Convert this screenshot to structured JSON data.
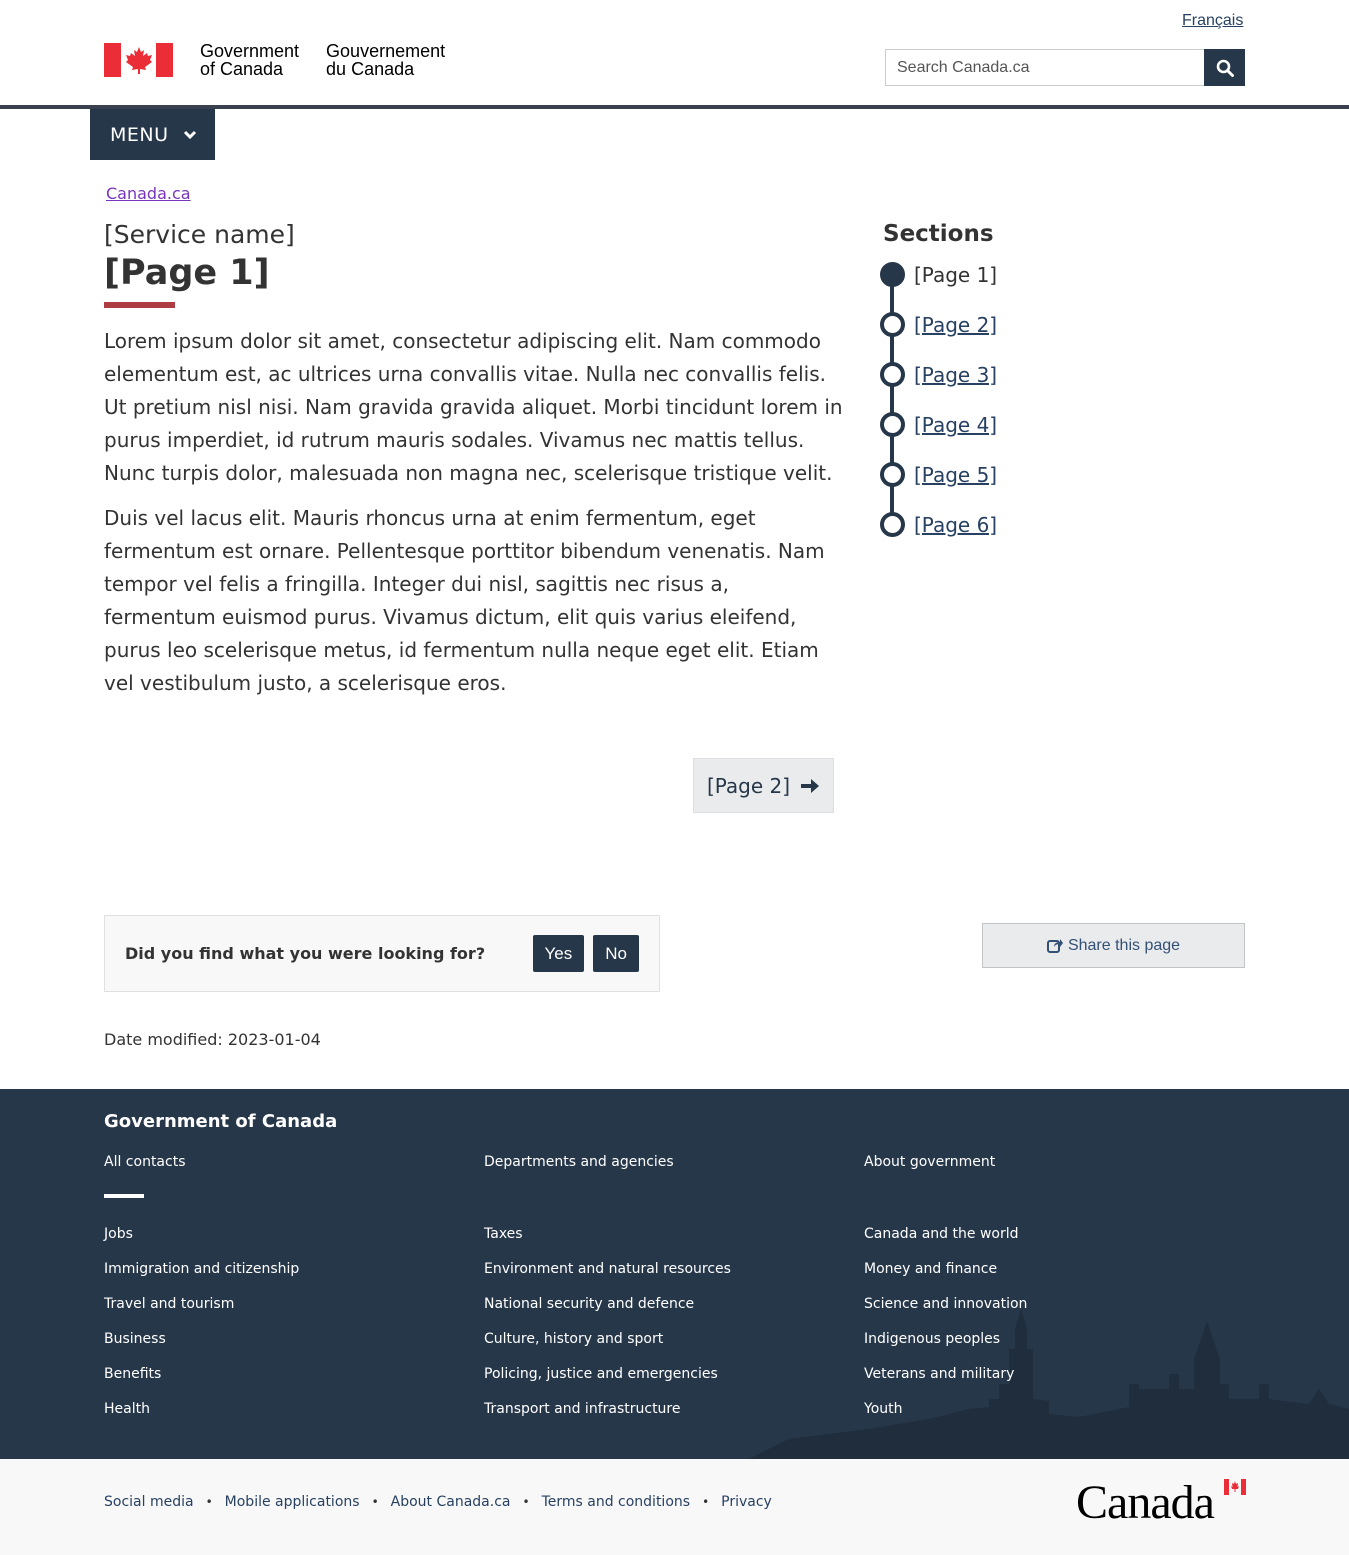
{
  "header": {
    "language_link": "Français",
    "wordmark_en": "Government\nof Canada",
    "wordmark_fr": "Gouvernement\ndu Canada",
    "search_placeholder": "Search Canada.ca",
    "menu_label": "MENU",
    "icons": {
      "search": "search-icon",
      "menu_chevron": "chevron-down-icon",
      "flag": "canada-flag-icon"
    },
    "colors": {
      "flag_red": "#eb2d37",
      "nav_dark": "#26374a"
    }
  },
  "breadcrumb": {
    "items": [
      "Canada.ca"
    ]
  },
  "main": {
    "service_name": "[Service name]",
    "page_title": "[Page 1]",
    "paragraphs": [
      "Lorem ipsum dolor sit amet, consectetur adipiscing elit. Nam commodo elementum est, ac ultrices urna convallis vitae. Nulla nec convallis felis. Ut pretium nisl nisi. Nam gravida gravida aliquet. Morbi tincidunt lorem in purus imperdiet, id rutrum mauris sodales. Vivamus nec mattis tellus. Nunc turpis dolor, malesuada non magna nec, scelerisque tristique velit.",
      "Duis vel lacus elit. Mauris rhoncus urna at enim fermentum, eget fermentum est ornare. Pellentesque porttitor bibendum venenatis. Nam tempor vel felis a fringilla. Integer dui nisl, sagittis nec risus a, fermentum euismod purus. Vivamus dictum, elit quis varius eleifend, purus leo scelerisque metus, id fermentum nulla neque eget elit. Etiam vel vestibulum justo, a scelerisque eros."
    ],
    "next_button": "[Page 2]",
    "accent_color": "#af3c43"
  },
  "sections": {
    "title": "Sections",
    "items": [
      {
        "label": "[Page 1]",
        "current": true
      },
      {
        "label": "[Page 2]",
        "current": false
      },
      {
        "label": "[Page 3]",
        "current": false
      },
      {
        "label": "[Page 4]",
        "current": false
      },
      {
        "label": "[Page 5]",
        "current": false
      },
      {
        "label": "[Page 6]",
        "current": false
      }
    ]
  },
  "feedback": {
    "question": "Did you find what you were looking for?",
    "yes": "Yes",
    "no": "No"
  },
  "share": {
    "label": "Share this page",
    "icon": "share-icon"
  },
  "date_modified": "Date modified: 2023-01-04",
  "footer": {
    "title": "Government of Canada",
    "top_links": [
      "All contacts",
      "Departments and agencies",
      "About government"
    ],
    "columns": [
      [
        "Jobs",
        "Immigration and citizenship",
        "Travel and tourism",
        "Business",
        "Benefits",
        "Health"
      ],
      [
        "Taxes",
        "Environment and natural resources",
        "National security and defence",
        "Culture, history and sport",
        "Policing, justice and emergencies",
        "Transport and infrastructure"
      ],
      [
        "Canada and the world",
        "Money and finance",
        "Science and innovation",
        "Indigenous peoples",
        "Veterans and military",
        "Youth"
      ]
    ],
    "bottom_links": [
      "Social media",
      "Mobile applications",
      "About Canada.ca",
      "Terms and conditions",
      "Privacy"
    ],
    "canada_wordmark": "Canada"
  }
}
